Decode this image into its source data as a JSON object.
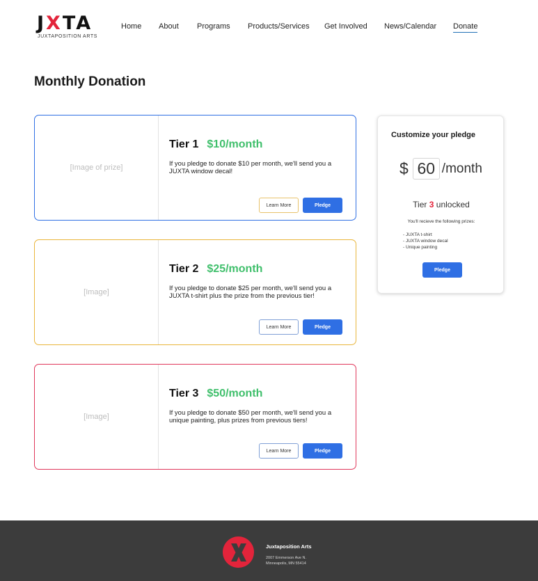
{
  "brand": {
    "logo_word_left": "J",
    "logo_word_x": "X",
    "logo_word_right": "TA",
    "logo_sub": "JUXTAPOSITION ARTS",
    "accent_color": "#e3243b"
  },
  "nav": {
    "items": [
      "Home",
      "About",
      "Programs",
      "Products/Services",
      "Get Involved",
      "News/Calendar",
      "Donate"
    ],
    "active": "Donate"
  },
  "page": {
    "title": "Monthly Donation"
  },
  "tiers": [
    {
      "image_label": "[Image of prize]",
      "name": "Tier 1",
      "price": "$10/month",
      "description": "If you pledge to donate $10 per month, we'll send you a JUXTA window decal!",
      "learn_more": "Learn More",
      "pledge": "Pledge",
      "border_color": "#2f6fe4",
      "learn_border_color": "#e8c26a"
    },
    {
      "image_label": "[Image]",
      "name": "Tier 2",
      "price": "$25/month",
      "description": "If you pledge to donate $25 per month, we'll send you a JUXTA t-shirt plus the prize from the previous tier!",
      "learn_more": "Learn More",
      "pledge": "Pledge",
      "border_color": "#e9b53a",
      "learn_border_color": "#7f9fd6"
    },
    {
      "image_label": "[Image]",
      "name": "Tier 3",
      "price": "$50/month",
      "description": "If you pledge to donate $50 per month, we'll send you a unique painting, plus prizes from previous tiers!",
      "learn_more": "Learn More",
      "pledge": "Pledge",
      "border_color": "#e0365a",
      "learn_border_color": "#7f9fd6"
    }
  ],
  "customize": {
    "title": "Customize your pledge",
    "currency": "$",
    "amount": "60",
    "per": "/month",
    "unlocked_prefix": "Tier",
    "unlocked_tier": "3",
    "unlocked_suffix": "unlocked",
    "prizes_intro": "You'll recieve the following prizes:",
    "prizes": [
      "- JUXTA t-shirt",
      "- JUXTA window decal",
      "- Unique painting"
    ],
    "pledge": "Pledge"
  },
  "footer": {
    "logo_letter": "X",
    "org_name": "Juxtaposition Arts",
    "address_line1": "2007 Emmerson Ave N.",
    "address_line2": "Minneapolis, MN 55414"
  },
  "colors": {
    "price_green": "#3fbf6b",
    "button_blue": "#2f6fe4",
    "footer_bg": "#3c3c3c",
    "nav_active_underline": "#1f6fb5"
  }
}
